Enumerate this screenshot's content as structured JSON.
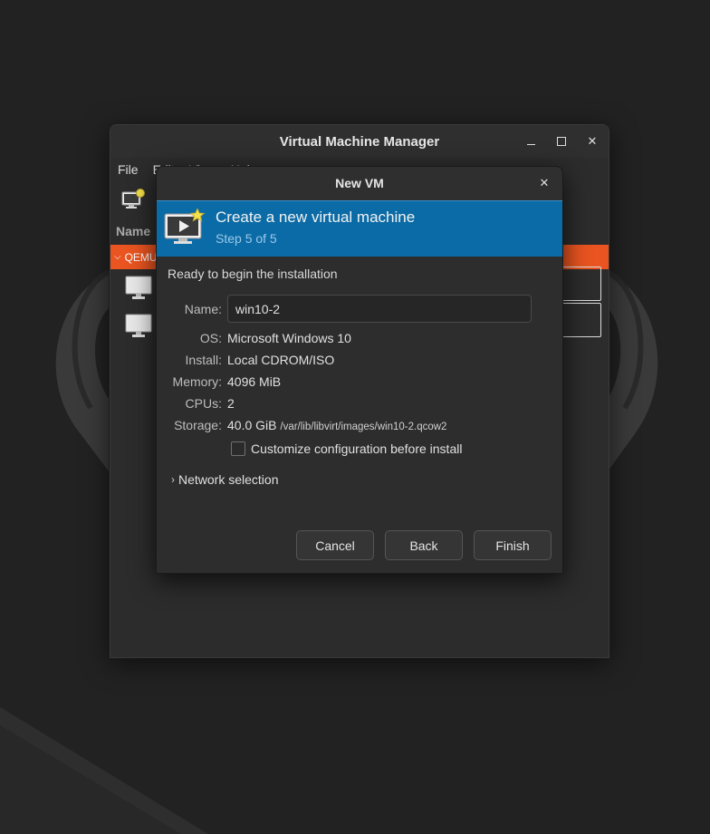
{
  "main_window": {
    "title": "Virtual Machine Manager",
    "menu": [
      "File",
      "Edit",
      "View",
      "Help"
    ],
    "list_header": "Name",
    "group_label": "QEMU/KVM"
  },
  "dialog": {
    "title": "New VM",
    "banner_title": "Create a new virtual machine",
    "banner_step": "Step 5 of 5",
    "ready_text": "Ready to begin the installation",
    "fields": {
      "name_label": "Name:",
      "name_value": "win10-2",
      "os_label": "OS:",
      "os_value": "Microsoft Windows 10",
      "install_label": "Install:",
      "install_value": "Local CDROM/ISO",
      "memory_label": "Memory:",
      "memory_value": "4096 MiB",
      "cpus_label": "CPUs:",
      "cpus_value": "2",
      "storage_label": "Storage:",
      "storage_size": "40.0 GiB",
      "storage_path": "/var/lib/libvirt/images/win10-2.qcow2"
    },
    "customize_label": "Customize configuration before install",
    "customize_checked": false,
    "network_selection_label": "Network selection",
    "buttons": {
      "cancel": "Cancel",
      "back": "Back",
      "finish": "Finish"
    }
  },
  "colors": {
    "banner": "#0b6ba6",
    "group_row": "#e95420",
    "desktop": "#222222"
  }
}
